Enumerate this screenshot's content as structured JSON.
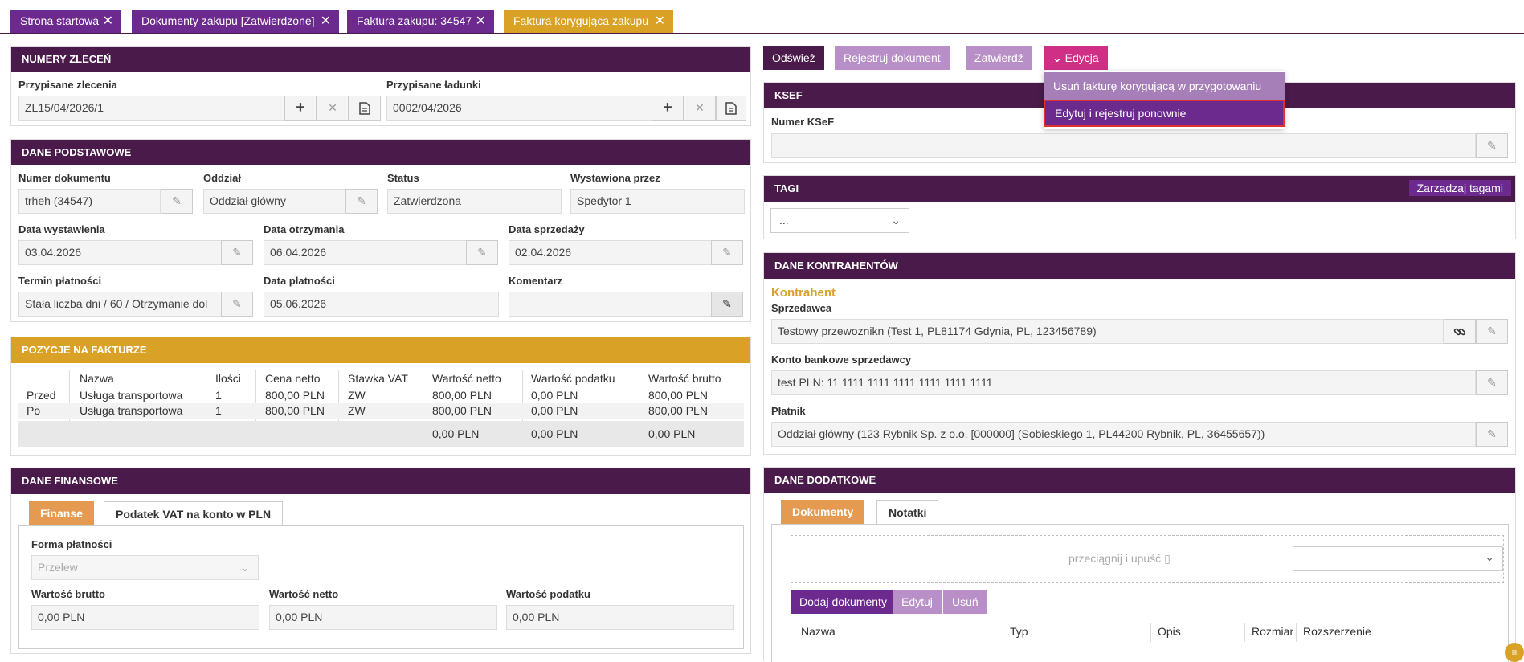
{
  "tabs": [
    {
      "label": "Strona startowa"
    },
    {
      "label": "Dokumenty zakupu [Zatwierdzone]"
    },
    {
      "label": "Faktura zakupu: 34547"
    },
    {
      "label": "Faktura korygująca zakupu"
    }
  ],
  "colors": {
    "primary": "#4a1a4a",
    "accent": "#d9a227",
    "light_button": "#b88fc6",
    "edit_button": "#d02f86",
    "highlight_border": "#e03030"
  },
  "orders": {
    "title": "NUMERY ZLECEŃ",
    "assigned_orders_label": "Przypisane zlecenia",
    "assigned_orders_value": "ZL15/04/2026/1",
    "assigned_loads_label": "Przypisane ładunki",
    "assigned_loads_value": "0002/04/2026"
  },
  "basic": {
    "title": "DANE PODSTAWOWE",
    "doc_number_label": "Numer dokumentu",
    "doc_number_value": "trheh (34547)",
    "branch_label": "Oddział",
    "branch_value": "Oddział główny",
    "status_label": "Status",
    "status_value": "Zatwierdzona",
    "issued_by_label": "Wystawiona przez",
    "issued_by_value": "Spedytor 1",
    "issue_date_label": "Data wystawienia",
    "issue_date_value": "03.04.2026",
    "receipt_date_label": "Data otrzymania",
    "receipt_date_value": "06.04.2026",
    "sale_date_label": "Data sprzedaży",
    "sale_date_value": "02.04.2026",
    "payment_term_label": "Termin płatności",
    "payment_term_value": "Stała liczba dni / 60 / Otrzymanie dol",
    "payment_date_label": "Data płatności",
    "payment_date_value": "05.06.2026",
    "comment_label": "Komentarz",
    "comment_value": ""
  },
  "items": {
    "title": "POZYCJE NA FAKTURZE",
    "headers": [
      "",
      "Nazwa",
      "Ilości",
      "Cena netto",
      "Stawka VAT",
      "Wartość netto",
      "Wartość podatku",
      "Wartość brutto"
    ],
    "rows": [
      [
        "Przed",
        "Usługa transportowa",
        "1",
        "800,00 PLN",
        "ZW",
        "800,00 PLN",
        "0,00 PLN",
        "800,00 PLN"
      ],
      [
        "Po",
        "Usługa transportowa",
        "1",
        "800,00 PLN",
        "ZW",
        "800,00 PLN",
        "0,00 PLN",
        "800,00 PLN"
      ]
    ],
    "totals": [
      "0,00 PLN",
      "0,00 PLN",
      "0,00 PLN"
    ]
  },
  "finance": {
    "title": "DANE FINANSOWE",
    "tab_active": "Finanse",
    "tab_other": "Podatek VAT na konto w PLN",
    "payment_form_label": "Forma płatności",
    "payment_form_value": "Przelew",
    "gross_label": "Wartość brutto",
    "gross_value": "0,00 PLN",
    "net_label": "Wartość netto",
    "net_value": "0,00 PLN",
    "tax_label": "Wartość podatku",
    "tax_value": "0,00 PLN"
  },
  "toolbar": {
    "refresh": "Odśwież",
    "register": "Rejestruj dokument",
    "approve": "Zatwierdź",
    "edit": "Edycja"
  },
  "edit_menu": {
    "item1": "Usuń fakturę korygującą w przygotowaniu",
    "item2": "Edytuj i rejestruj ponownie"
  },
  "ksef": {
    "title": "KSEF",
    "number_label": "Numer KSeF",
    "number_value": ""
  },
  "tags": {
    "title": "TAGI",
    "manage": "Zarządzaj tagami",
    "select_value": "..."
  },
  "contractors": {
    "title": "DANE KONTRAHENTÓW",
    "subtitle": "Kontrahent",
    "seller_label": "Sprzedawca",
    "seller_value": "Testowy przewoznikn (Test 1, PL81174 Gdynia, PL, 123456789)",
    "bank_label": "Konto bankowe sprzedawcy",
    "bank_value": "test PLN: 11 1111 1111 1111 1111 1111 1111",
    "payer_label": "Płatnik",
    "payer_value": "Oddział główny (123 Rybnik Sp. z o.o. [000000] (Sobieskiego 1, PL44200 Rybnik, PL, 36455657))"
  },
  "additional": {
    "title": "DANE DODATKOWE",
    "tab_active": "Dokumenty",
    "tab_other": "Notatki",
    "drop_text": "przeciągnij i upuść",
    "add_docs": "Dodaj dokumenty",
    "edit": "Edytuj",
    "delete": "Usuń",
    "headers": [
      "Nazwa",
      "Typ",
      "Opis",
      "Rozmiar",
      "Rozszerzenie"
    ]
  }
}
